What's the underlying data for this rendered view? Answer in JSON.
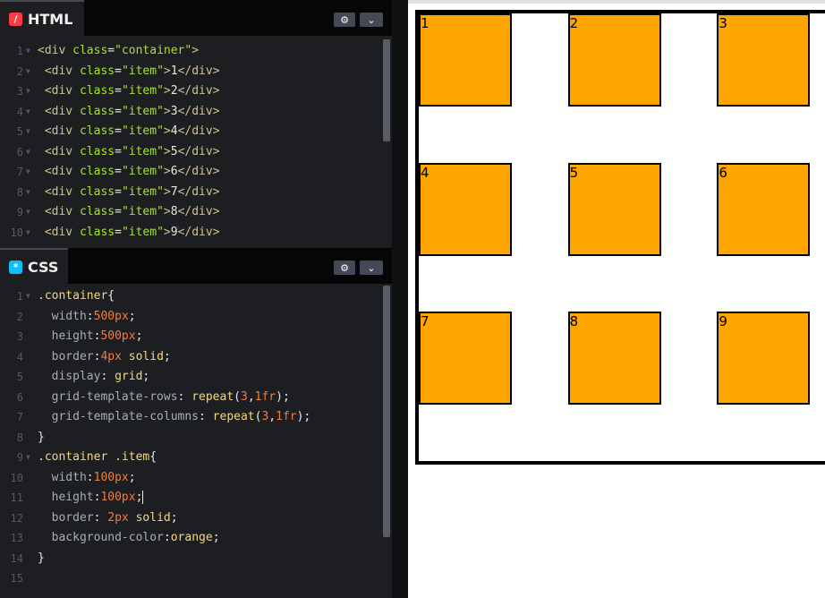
{
  "html_panel": {
    "tab_label": "HTML",
    "icon": "html-slash-icon",
    "icon_color": "#ff3c41",
    "lines": [
      [
        [
          "t-tag",
          "<div "
        ],
        [
          "t-attr",
          "class"
        ],
        [
          "t-pun",
          "="
        ],
        [
          "t-str",
          "\"container\""
        ],
        [
          "t-tag",
          ">"
        ]
      ],
      [
        [
          "t-tag",
          " <div "
        ],
        [
          "t-attr",
          "class"
        ],
        [
          "t-pun",
          "="
        ],
        [
          "t-str",
          "\"item\""
        ],
        [
          "t-tag",
          ">"
        ],
        [
          "t-txt",
          "1"
        ],
        [
          "t-tag",
          "</div>"
        ]
      ],
      [
        [
          "t-tag",
          " <div "
        ],
        [
          "t-attr",
          "class"
        ],
        [
          "t-pun",
          "="
        ],
        [
          "t-str",
          "\"item\""
        ],
        [
          "t-tag",
          ">"
        ],
        [
          "t-txt",
          "2"
        ],
        [
          "t-tag",
          "</div>"
        ]
      ],
      [
        [
          "t-tag",
          " <div "
        ],
        [
          "t-attr",
          "class"
        ],
        [
          "t-pun",
          "="
        ],
        [
          "t-str",
          "\"item\""
        ],
        [
          "t-tag",
          ">"
        ],
        [
          "t-txt",
          "3"
        ],
        [
          "t-tag",
          "</div>"
        ]
      ],
      [
        [
          "t-tag",
          " <div "
        ],
        [
          "t-attr",
          "class"
        ],
        [
          "t-pun",
          "="
        ],
        [
          "t-str",
          "\"item\""
        ],
        [
          "t-tag",
          ">"
        ],
        [
          "t-txt",
          "4"
        ],
        [
          "t-tag",
          "</div>"
        ]
      ],
      [
        [
          "t-tag",
          " <div "
        ],
        [
          "t-attr",
          "class"
        ],
        [
          "t-pun",
          "="
        ],
        [
          "t-str",
          "\"item\""
        ],
        [
          "t-tag",
          ">"
        ],
        [
          "t-txt",
          "5"
        ],
        [
          "t-tag",
          "</div>"
        ]
      ],
      [
        [
          "t-tag",
          " <div "
        ],
        [
          "t-attr",
          "class"
        ],
        [
          "t-pun",
          "="
        ],
        [
          "t-str",
          "\"item\""
        ],
        [
          "t-tag",
          ">"
        ],
        [
          "t-txt",
          "6"
        ],
        [
          "t-tag",
          "</div>"
        ]
      ],
      [
        [
          "t-tag",
          " <div "
        ],
        [
          "t-attr",
          "class"
        ],
        [
          "t-pun",
          "="
        ],
        [
          "t-str",
          "\"item\""
        ],
        [
          "t-tag",
          ">"
        ],
        [
          "t-txt",
          "7"
        ],
        [
          "t-tag",
          "</div>"
        ]
      ],
      [
        [
          "t-tag",
          " <div "
        ],
        [
          "t-attr",
          "class"
        ],
        [
          "t-pun",
          "="
        ],
        [
          "t-str",
          "\"item\""
        ],
        [
          "t-tag",
          ">"
        ],
        [
          "t-txt",
          "8"
        ],
        [
          "t-tag",
          "</div>"
        ]
      ],
      [
        [
          "t-tag",
          " <div "
        ],
        [
          "t-attr",
          "class"
        ],
        [
          "t-pun",
          "="
        ],
        [
          "t-str",
          "\"item\""
        ],
        [
          "t-tag",
          ">"
        ],
        [
          "t-txt",
          "9"
        ],
        [
          "t-tag",
          "</div>"
        ]
      ]
    ]
  },
  "css_panel": {
    "tab_label": "CSS",
    "icon": "css-asterisk-icon",
    "icon_color": "#0ebeff",
    "lines": [
      [
        [
          "t-sel",
          ".container"
        ],
        [
          "t-pun",
          "{"
        ]
      ],
      [
        [
          "t-prop",
          "  width"
        ],
        [
          "t-pun",
          ":"
        ],
        [
          "t-num",
          "500px"
        ],
        [
          "t-pun",
          ";"
        ]
      ],
      [
        [
          "t-prop",
          "  height"
        ],
        [
          "t-pun",
          ":"
        ],
        [
          "t-num",
          "500px"
        ],
        [
          "t-pun",
          ";"
        ]
      ],
      [
        [
          "t-prop",
          "  border"
        ],
        [
          "t-pun",
          ":"
        ],
        [
          "t-num",
          "4px"
        ],
        [
          "t-val",
          " solid"
        ],
        [
          "t-pun",
          ";"
        ]
      ],
      [
        [
          "t-prop",
          "  display"
        ],
        [
          "t-pun",
          ": "
        ],
        [
          "t-val",
          "grid"
        ],
        [
          "t-pun",
          ";"
        ]
      ],
      [
        [
          "t-prop",
          "  grid-template-rows"
        ],
        [
          "t-pun",
          ": "
        ],
        [
          "t-val",
          "repeat"
        ],
        [
          "t-pun",
          "("
        ],
        [
          "t-num",
          "3"
        ],
        [
          "t-pun",
          ","
        ],
        [
          "t-num",
          "1fr"
        ],
        [
          "t-pun",
          ");"
        ]
      ],
      [
        [
          "t-prop",
          "  grid-template-columns"
        ],
        [
          "t-pun",
          ": "
        ],
        [
          "t-val",
          "repeat"
        ],
        [
          "t-pun",
          "("
        ],
        [
          "t-num",
          "3"
        ],
        [
          "t-pun",
          ","
        ],
        [
          "t-num",
          "1fr"
        ],
        [
          "t-pun",
          ");"
        ]
      ],
      [
        [
          "t-pun",
          "}"
        ]
      ],
      [
        [
          "t-sel",
          ".container .item"
        ],
        [
          "t-pun",
          "{"
        ]
      ],
      [
        [
          "t-prop",
          "  width"
        ],
        [
          "t-pun",
          ":"
        ],
        [
          "t-num",
          "100px"
        ],
        [
          "t-pun",
          ";"
        ]
      ],
      [
        [
          "t-prop",
          "  height"
        ],
        [
          "t-pun",
          ":"
        ],
        [
          "t-num",
          "100px"
        ],
        [
          "t-pun",
          ";"
        ]
      ],
      [
        [
          "t-prop",
          "  border"
        ],
        [
          "t-pun",
          ": "
        ],
        [
          "t-num",
          "2px"
        ],
        [
          "t-val",
          " solid"
        ],
        [
          "t-pun",
          ";"
        ]
      ],
      [
        [
          "t-prop",
          "  background-color"
        ],
        [
          "t-pun",
          ":"
        ],
        [
          "t-val",
          "orange"
        ],
        [
          "t-pun",
          ";"
        ]
      ],
      [
        [
          "t-pun",
          "}"
        ]
      ],
      []
    ],
    "fold_lines": [
      1,
      9
    ]
  },
  "toolbar": {
    "settings_icon": "gear-icon",
    "collapse_icon": "chevron-down-icon"
  },
  "preview": {
    "items": [
      "1",
      "2",
      "3",
      "4",
      "5",
      "6",
      "7",
      "8",
      "9"
    ],
    "item_color": "#ffa500"
  }
}
